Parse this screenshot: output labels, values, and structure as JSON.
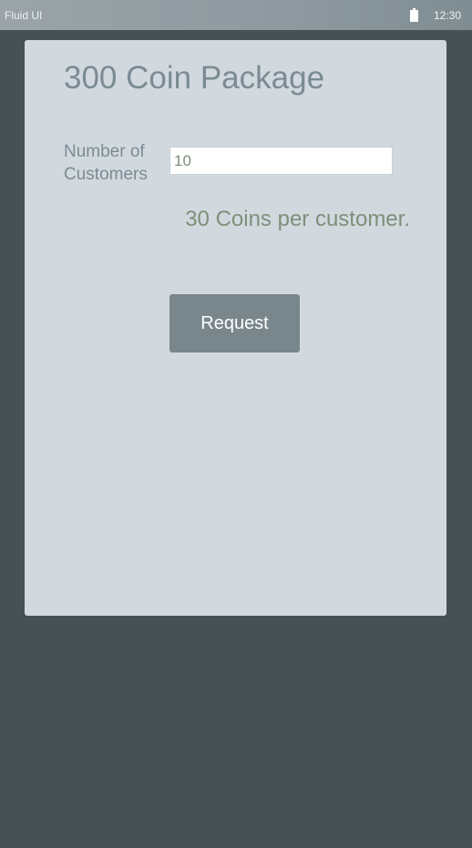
{
  "status_bar": {
    "app_name": "Fluid UI",
    "battery_icon": "battery-icon",
    "time": "12:30"
  },
  "card": {
    "title": "300 Coin Package",
    "customers_label_line1": "Number of",
    "customers_label_line2": "Customers",
    "customers_value": "10",
    "coins_text": "30 Coins per customer.",
    "request_label": "Request"
  },
  "colors": {
    "background": "#465156",
    "card": "#d1d9df",
    "title_text": "#7c8b93",
    "coins_text": "#7e8f7a",
    "button": "#79878d"
  }
}
